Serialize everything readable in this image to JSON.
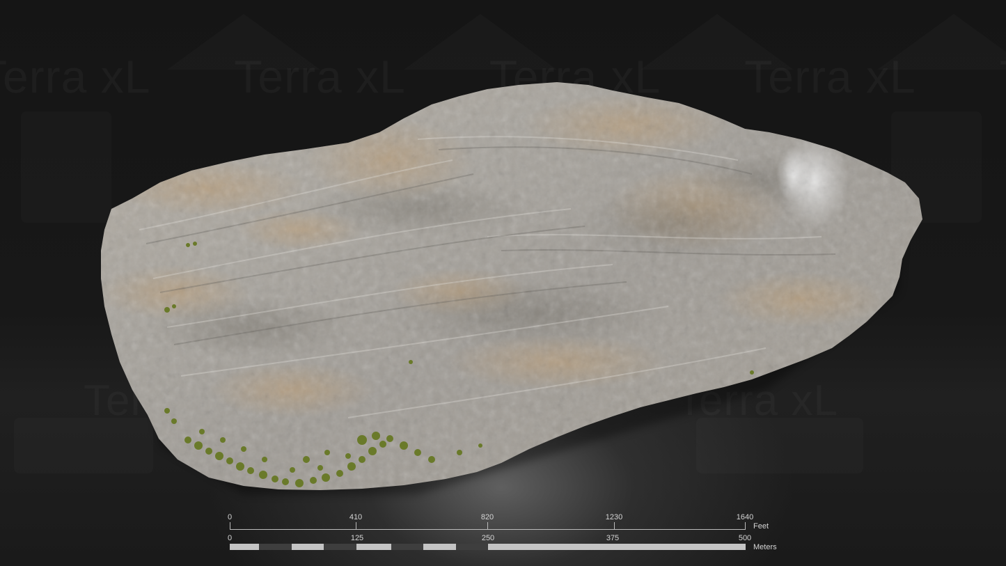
{
  "watermark": {
    "text": "Terra xL"
  },
  "scale_bar": {
    "feet": {
      "ticks": [
        "0",
        "410",
        "820",
        "1230",
        "1640"
      ],
      "unit": "Feet"
    },
    "meters": {
      "ticks": [
        "0",
        "125",
        "250",
        "375",
        "500"
      ],
      "unit": "Meters"
    },
    "colors": {
      "light": "#c4c4c4",
      "dark": "#3e3e3e"
    }
  },
  "colors": {
    "background": "#141414",
    "rock_base": "#a9a7a2",
    "rock_tan": "#b19a7c",
    "vegetation": "#6a7a2a"
  }
}
